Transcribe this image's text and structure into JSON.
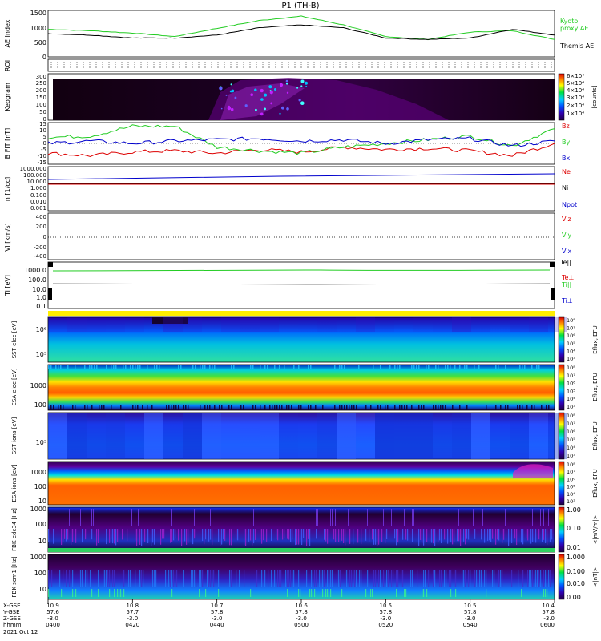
{
  "title": "P1 (TH-B)",
  "colors": {
    "green": "#22cc22",
    "black": "#000000",
    "red": "#dd0000",
    "blue": "#0000cc",
    "maroon": "#8b1a1a",
    "yellow": "#ffee00"
  },
  "panels": {
    "ae": {
      "ylabel": "AE Index",
      "yticks": [
        "1500",
        "1000",
        "500",
        "0"
      ],
      "ylim": [
        0,
        1600
      ],
      "legend": [
        {
          "text": "Kyoto",
          "color": "#22cc22"
        },
        {
          "text": "proxy AE",
          "color": "#22cc22"
        },
        {
          "text": "Themis AE",
          "color": "#000000"
        }
      ]
    },
    "roi": {
      "ylabel": "ROI"
    },
    "keogram": {
      "ylabel": "Keogram",
      "yticks": [
        "300",
        "250",
        "200",
        "150",
        "100",
        "50",
        "0"
      ],
      "colorbar_ticks": [
        "6×10⁴",
        "5×10⁴",
        "4×10⁴",
        "3×10⁴",
        "2×10⁴",
        "1×10⁴"
      ],
      "colorbar_unit": "[counts]"
    },
    "bfgm": {
      "ylabel": "B FIT [nT]",
      "yticks": [
        "15",
        "10",
        "5",
        "0",
        "-5",
        "-10",
        "-15"
      ],
      "ylim": [
        -17,
        17
      ],
      "legend": [
        {
          "text": "Bz",
          "color": "#dd0000"
        },
        {
          "text": "By",
          "color": "#22cc22"
        },
        {
          "text": "Bx",
          "color": "#0000cc"
        }
      ]
    },
    "density": {
      "ylabel": "n [1/cc]",
      "yticks": [
        "1000.000",
        "100.000",
        "10.000",
        "1.000",
        "0.100",
        "0.010",
        "0.001"
      ],
      "legend": [
        {
          "text": "Ne",
          "color": "#dd0000"
        },
        {
          "text": "Ni",
          "color": "#000000"
        },
        {
          "text": "Npot",
          "color": "#0000cc"
        }
      ]
    },
    "velocity": {
      "ylabel": "Vi [km/s]",
      "yticks": [
        "400",
        "200",
        "0",
        "-200",
        "-400"
      ],
      "legend": [
        {
          "text": "Viz",
          "color": "#dd0000"
        },
        {
          "text": "Viy",
          "color": "#22cc22"
        },
        {
          "text": "Vix",
          "color": "#0000cc"
        }
      ]
    },
    "temperature": {
      "ylabel": "Ti [eV]",
      "yticks": [
        "1000.0",
        "100.0",
        "10.0",
        "1.0",
        "0.1"
      ],
      "legend": [
        {
          "text": "Te||",
          "color": "#000000"
        },
        {
          "text": "Te⊥",
          "color": "#dd0000"
        },
        {
          "text": "Ti||",
          "color": "#22cc22"
        },
        {
          "text": "Ti⊥",
          "color": "#0000cc"
        }
      ]
    },
    "sst_e": {
      "ylabel": "SST elec [eV]",
      "yticks": [
        "10⁶",
        "10⁵"
      ],
      "cbar_label": "Eflux, EFU"
    },
    "esa_e": {
      "ylabel": "ESA elec [eV]",
      "yticks": [
        "1000",
        "100"
      ],
      "cbar_label": "Eflux, EFU"
    },
    "sst_i": {
      "ylabel": "SST ions [eV]",
      "yticks": [
        "10⁵"
      ],
      "cbar_label": "Eflux, EFU"
    },
    "esa_i": {
      "ylabel": "ESA ions [eV]",
      "yticks": [
        "1000",
        "100",
        "10"
      ],
      "cbar_label": "Eflux, EFU"
    },
    "fbk1": {
      "ylabel": "FBK edc34 [Hz]",
      "yticks": [
        "1000",
        "100",
        "10"
      ],
      "cbar_label": "<|mV/m|>",
      "cbar_ticks": [
        "1.00",
        "0.10",
        "0.01"
      ]
    },
    "fbk2": {
      "ylabel": "FBK scm1 [Hz]",
      "yticks": [
        "1000",
        "100",
        "10"
      ],
      "cbar_label": "<|nT|>",
      "cbar_ticks": [
        "1.000",
        "0.100",
        "0.010",
        "0.001"
      ]
    }
  },
  "efu_ticks": [
    "10⁸",
    "10⁷",
    "10⁶",
    "10⁵",
    "10⁴",
    "10³"
  ],
  "xaxis": {
    "row_labels": [
      "X-GSE",
      "Y-GSE",
      "Z-GSE",
      "hhmm",
      "2021 Oct 12"
    ],
    "columns": [
      {
        "x": "10.9",
        "y": "57.6",
        "z": "-3.0",
        "t": "0400"
      },
      {
        "x": "10.8",
        "y": "57.7",
        "z": "-3.0",
        "t": "0420"
      },
      {
        "x": "10.7",
        "y": "57.8",
        "z": "-3.0",
        "t": "0440"
      },
      {
        "x": "10.6",
        "y": "57.8",
        "z": "-3.0",
        "t": "0500"
      },
      {
        "x": "10.5",
        "y": "57.8",
        "z": "-3.0",
        "t": "0520"
      },
      {
        "x": "10.5",
        "y": "57.8",
        "z": "-3.0",
        "t": "0540"
      },
      {
        "x": "10.4",
        "y": "57.8",
        "z": "-3.0",
        "t": "0600"
      }
    ]
  },
  "chart_data": [
    {
      "type": "line",
      "panel": "AE Index",
      "x": [
        "0400",
        "0410",
        "0420",
        "0430",
        "0440",
        "0450",
        "0500",
        "0510",
        "0520",
        "0530",
        "0540",
        "0550",
        "0600"
      ],
      "series": [
        {
          "name": "Kyoto proxy AE",
          "values": [
            950,
            900,
            820,
            700,
            980,
            1250,
            1400,
            1100,
            700,
            600,
            850,
            900,
            600
          ]
        },
        {
          "name": "Themis AE",
          "values": [
            800,
            750,
            650,
            650,
            750,
            1000,
            1100,
            1000,
            650,
            600,
            650,
            950,
            750
          ]
        }
      ],
      "ylim": [
        0,
        1600
      ]
    },
    {
      "type": "line",
      "panel": "B FIT",
      "x": [
        "0400",
        "0410",
        "0420",
        "0430",
        "0440",
        "0450",
        "0500",
        "0510",
        "0520",
        "0530",
        "0540",
        "0550",
        "0600"
      ],
      "series": [
        {
          "name": "Bz",
          "values": [
            -8,
            -10,
            -7,
            -6,
            -8,
            -5,
            -7,
            -3,
            -5,
            -4,
            -6,
            -10,
            0
          ]
        },
        {
          "name": "By",
          "values": [
            5,
            6,
            14,
            14,
            -3,
            -6,
            -8,
            -3,
            0,
            3,
            6,
            -2,
            12
          ]
        },
        {
          "name": "Bx",
          "values": [
            0,
            2,
            0,
            2,
            3,
            4,
            2,
            3,
            0,
            3,
            4,
            -2,
            2
          ]
        }
      ],
      "ylim": [
        -17,
        17
      ]
    }
  ]
}
